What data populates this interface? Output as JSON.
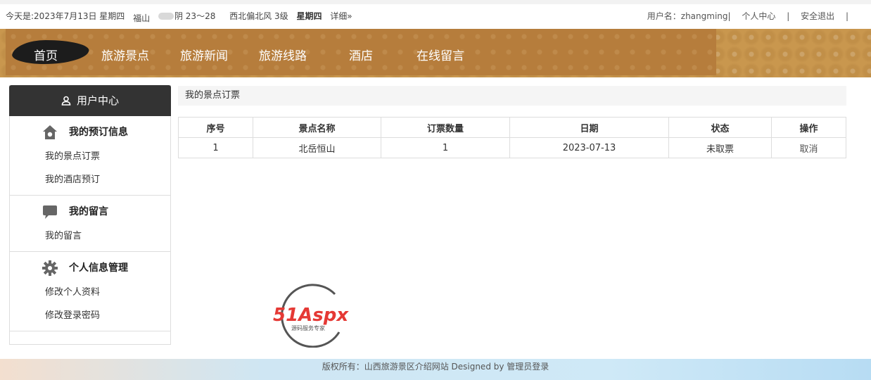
{
  "topbar": {
    "date": "今天是:2023年7月13日 星期四",
    "city": "福山",
    "weather": "阴 23～28",
    "wind": "西北偏北风 3级",
    "weekday": "星期四",
    "detail": "详细»",
    "user_label": "用户名：zhangming|",
    "personal_center": "个人中心",
    "separator": "|",
    "logout": "安全退出",
    "end_sep": "|"
  },
  "nav": {
    "items": [
      "首页",
      "旅游景点",
      "旅游新闻",
      "旅游线路",
      "酒店",
      "在线留言"
    ]
  },
  "sidebar": {
    "title": "用户中心",
    "sections": [
      {
        "title": "我的预订信息",
        "icon": "home-icon",
        "links": [
          "我的景点订票",
          "我的酒店预订"
        ]
      },
      {
        "title": "我的留言",
        "icon": "chat-bubble-icon",
        "links": [
          "我的留言"
        ]
      },
      {
        "title": "个人信息管理",
        "icon": "gear-icon",
        "links": [
          "修改个人资料",
          "修改登录密码"
        ]
      }
    ]
  },
  "content": {
    "breadcrumb": "我的景点订票",
    "table": {
      "headers": [
        "序号",
        "景点名称",
        "订票数量",
        "日期",
        "状态",
        "操作"
      ],
      "rows": [
        [
          "1",
          "北岳恒山",
          "1",
          "2023-07-13",
          "未取票",
          "取消"
        ]
      ]
    }
  },
  "watermark": {
    "brand": "51Aspx",
    "tagline": "源码服务专家",
    "brand_colors": [
      "#e53935",
      "#555555",
      "#43a047"
    ]
  },
  "footer": {
    "copyright": "版权所有：山西旅游景区介绍网站 Designed by",
    "admin_login": "管理员登录"
  }
}
